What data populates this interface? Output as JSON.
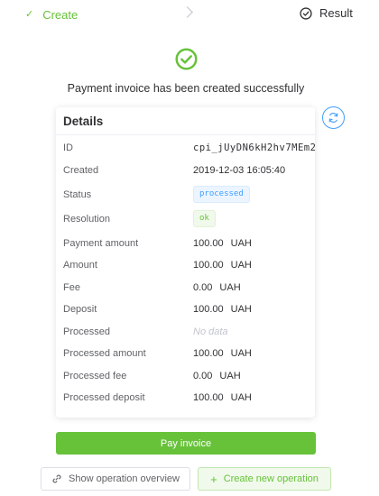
{
  "steps": {
    "create_label": "Create",
    "result_label": "Result",
    "check_glyph": "✓"
  },
  "success": {
    "message": "Payment invoice has been created successfully"
  },
  "details": {
    "title": "Details",
    "rows": [
      {
        "label": "ID",
        "value": "cpi_jUyDN6kH2hv7MEm2"
      },
      {
        "label": "Created",
        "value": "2019-12-03 16:05:40"
      },
      {
        "label": "Status",
        "value": "processed"
      },
      {
        "label": "Resolution",
        "value": "ok"
      },
      {
        "label": "Payment amount",
        "value": "100.00",
        "currency": "UAH"
      },
      {
        "label": "Amount",
        "value": "100.00",
        "currency": "UAH"
      },
      {
        "label": "Fee",
        "value": "0.00",
        "currency": "UAH"
      },
      {
        "label": "Deposit",
        "value": "100.00",
        "currency": "UAH"
      },
      {
        "label": "Processed",
        "value": "No data"
      },
      {
        "label": "Processed amount",
        "value": "100.00",
        "currency": "UAH"
      },
      {
        "label": "Processed fee",
        "value": "0.00",
        "currency": "UAH"
      },
      {
        "label": "Processed deposit",
        "value": "100.00",
        "currency": "UAH"
      }
    ]
  },
  "actions": {
    "pay_label": "Pay invoice",
    "overview_label": "Show operation overview",
    "new_operation_label": "Create new operation",
    "plus_glyph": "+"
  },
  "colors": {
    "success": "#67c23a",
    "primary": "#409eff"
  },
  "icons": {
    "step_done": "check-icon",
    "result": "check-circle-icon",
    "success": "check-circle-icon",
    "refresh": "refresh-icon",
    "link": "link-icon",
    "plus": "plus-icon"
  }
}
